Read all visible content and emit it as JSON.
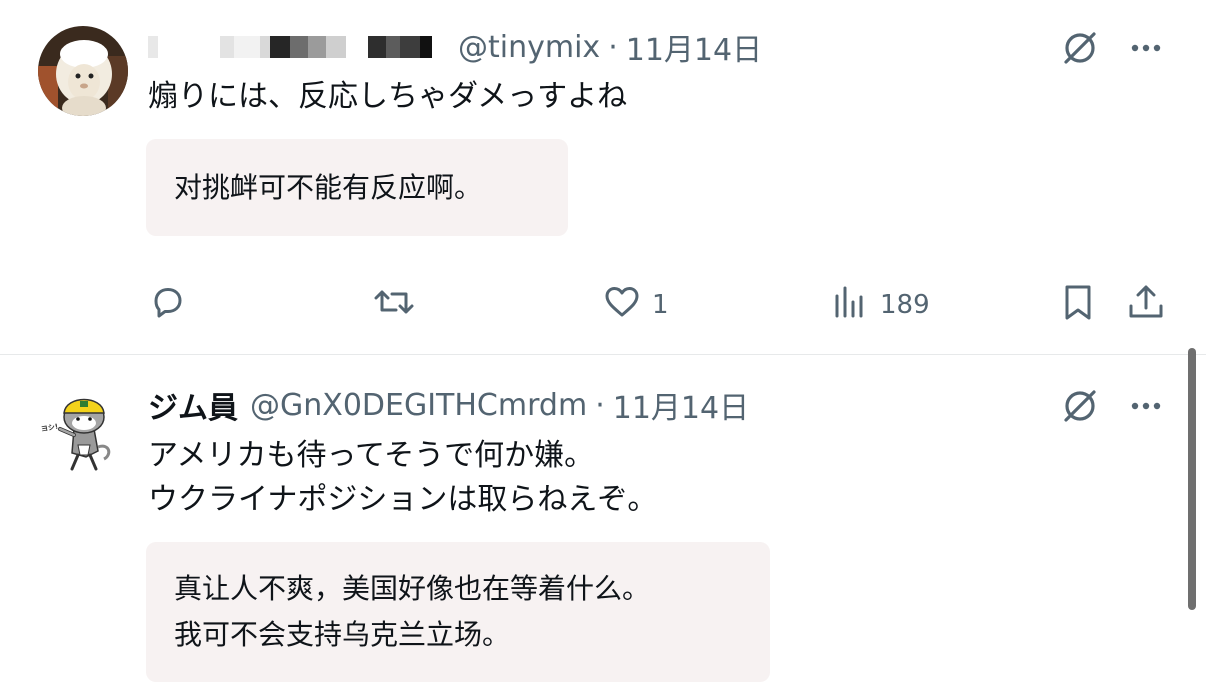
{
  "tweets": [
    {
      "display_name": "",
      "handle": "@tinymix",
      "separator": "·",
      "time": "11月14日",
      "text": "煽りには、反応しちゃダメっすよね",
      "translation": "对挑衅可不能有反应啊。",
      "actions": {
        "reply_count": "",
        "retweet_count": "",
        "like_count": "1",
        "view_count": "189"
      }
    },
    {
      "display_name": "ジム員",
      "handle": "@GnX0DEGITHCmrdm",
      "separator": "·",
      "time": "11月14日",
      "text_lines": [
        "アメリカも待ってそうで何か嫌。",
        "ウクライナポジションは取らねえぞ。"
      ],
      "translation_lines": [
        "真让人不爽，美国好像也在等着什么。",
        "我可不会支持乌克兰立场。"
      ],
      "avatar_badge_text": "ヨシ!"
    }
  ],
  "icons": {
    "grok": "grok-slash-icon",
    "more": "more-dots-icon",
    "reply": "reply-bubble-icon",
    "retweet": "retweet-icon",
    "like": "heart-icon",
    "views": "analytics-bars-icon",
    "bookmark": "bookmark-icon",
    "share": "share-upload-icon"
  },
  "colors": {
    "text": "#0f1419",
    "secondary": "#536471",
    "translation_bg": "#f7f2f2",
    "divider": "#e7e9ea"
  }
}
